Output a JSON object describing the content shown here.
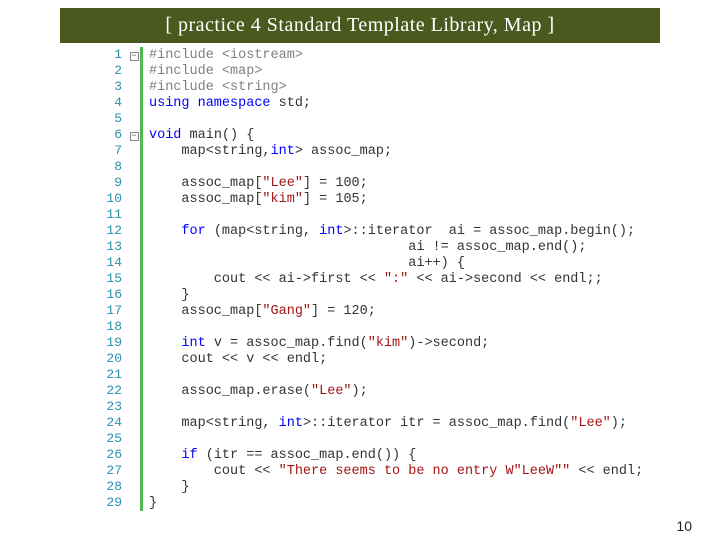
{
  "title": "[ practice 4 Standard Template Library, Map ]",
  "page_number": "10",
  "lines": [
    {
      "n": "1",
      "fold": "box",
      "spans": [
        {
          "t": "#include ",
          "c": "pp"
        },
        {
          "t": "<iostream>",
          "c": "inc"
        }
      ]
    },
    {
      "n": "2",
      "fold": "",
      "spans": [
        {
          "t": "#include ",
          "c": "pp"
        },
        {
          "t": "<map>",
          "c": "inc"
        }
      ]
    },
    {
      "n": "3",
      "fold": "",
      "spans": [
        {
          "t": "#include ",
          "c": "pp"
        },
        {
          "t": "<string>",
          "c": "inc"
        }
      ]
    },
    {
      "n": "4",
      "fold": "",
      "spans": [
        {
          "t": "using namespace ",
          "c": "kw"
        },
        {
          "t": "std;",
          "c": "id"
        }
      ]
    },
    {
      "n": "5",
      "fold": "",
      "spans": []
    },
    {
      "n": "6",
      "fold": "box",
      "spans": [
        {
          "t": "void ",
          "c": "kw"
        },
        {
          "t": "main() {",
          "c": "id"
        }
      ]
    },
    {
      "n": "7",
      "fold": "",
      "spans": [
        {
          "t": "    map<string,",
          "c": "id"
        },
        {
          "t": "int",
          "c": "kw"
        },
        {
          "t": "> assoc_map;",
          "c": "id"
        }
      ]
    },
    {
      "n": "8",
      "fold": "",
      "spans": []
    },
    {
      "n": "9",
      "fold": "",
      "spans": [
        {
          "t": "    assoc_map[",
          "c": "id"
        },
        {
          "t": "\"Lee\"",
          "c": "str"
        },
        {
          "t": "] = 100;",
          "c": "id"
        }
      ]
    },
    {
      "n": "10",
      "fold": "",
      "spans": [
        {
          "t": "    assoc_map[",
          "c": "id"
        },
        {
          "t": "\"kim\"",
          "c": "str"
        },
        {
          "t": "] = 105;",
          "c": "id"
        }
      ]
    },
    {
      "n": "11",
      "fold": "",
      "spans": []
    },
    {
      "n": "12",
      "fold": "",
      "spans": [
        {
          "t": "    ",
          "c": ""
        },
        {
          "t": "for ",
          "c": "kw"
        },
        {
          "t": "(map<string, ",
          "c": "id"
        },
        {
          "t": "int",
          "c": "kw"
        },
        {
          "t": ">::iterator  ai = assoc_map.begin();",
          "c": "id"
        }
      ]
    },
    {
      "n": "13",
      "fold": "",
      "spans": [
        {
          "t": "                                ai != assoc_map.end();",
          "c": "id"
        }
      ]
    },
    {
      "n": "14",
      "fold": "",
      "spans": [
        {
          "t": "                                ai++) {",
          "c": "id"
        }
      ]
    },
    {
      "n": "15",
      "fold": "",
      "spans": [
        {
          "t": "        cout << ai->first << ",
          "c": "id"
        },
        {
          "t": "\":\"",
          "c": "str"
        },
        {
          "t": " << ai->second << endl;;",
          "c": "id"
        }
      ]
    },
    {
      "n": "16",
      "fold": "",
      "spans": [
        {
          "t": "    }",
          "c": "id"
        }
      ]
    },
    {
      "n": "17",
      "fold": "",
      "spans": [
        {
          "t": "    assoc_map[",
          "c": "id"
        },
        {
          "t": "\"Gang\"",
          "c": "str"
        },
        {
          "t": "] = 120;",
          "c": "id"
        }
      ]
    },
    {
      "n": "18",
      "fold": "",
      "spans": []
    },
    {
      "n": "19",
      "fold": "",
      "spans": [
        {
          "t": "    ",
          "c": ""
        },
        {
          "t": "int ",
          "c": "kw"
        },
        {
          "t": "v = assoc_map.find(",
          "c": "id"
        },
        {
          "t": "\"kim\"",
          "c": "str"
        },
        {
          "t": ")->second;",
          "c": "id"
        }
      ]
    },
    {
      "n": "20",
      "fold": "",
      "spans": [
        {
          "t": "    cout << v << endl;",
          "c": "id"
        }
      ]
    },
    {
      "n": "21",
      "fold": "",
      "spans": []
    },
    {
      "n": "22",
      "fold": "",
      "spans": [
        {
          "t": "    assoc_map.erase(",
          "c": "id"
        },
        {
          "t": "\"Lee\"",
          "c": "str"
        },
        {
          "t": ");",
          "c": "id"
        }
      ]
    },
    {
      "n": "23",
      "fold": "",
      "spans": []
    },
    {
      "n": "24",
      "fold": "",
      "spans": [
        {
          "t": "    map<string, ",
          "c": "id"
        },
        {
          "t": "int",
          "c": "kw"
        },
        {
          "t": ">::iterator itr = assoc_map.find(",
          "c": "id"
        },
        {
          "t": "\"Lee\"",
          "c": "str"
        },
        {
          "t": ");",
          "c": "id"
        }
      ]
    },
    {
      "n": "25",
      "fold": "",
      "spans": []
    },
    {
      "n": "26",
      "fold": "",
      "spans": [
        {
          "t": "    ",
          "c": ""
        },
        {
          "t": "if ",
          "c": "kw"
        },
        {
          "t": "(itr == assoc_map.end()) {",
          "c": "id"
        }
      ]
    },
    {
      "n": "27",
      "fold": "",
      "spans": [
        {
          "t": "        cout << ",
          "c": "id"
        },
        {
          "t": "\"There seems to be no entry W\"LeeW\"\"",
          "c": "str"
        },
        {
          "t": " << endl;",
          "c": "id"
        }
      ]
    },
    {
      "n": "28",
      "fold": "",
      "spans": [
        {
          "t": "    }",
          "c": "id"
        }
      ]
    },
    {
      "n": "29",
      "fold": "",
      "spans": [
        {
          "t": "}",
          "c": "id"
        }
      ]
    }
  ]
}
